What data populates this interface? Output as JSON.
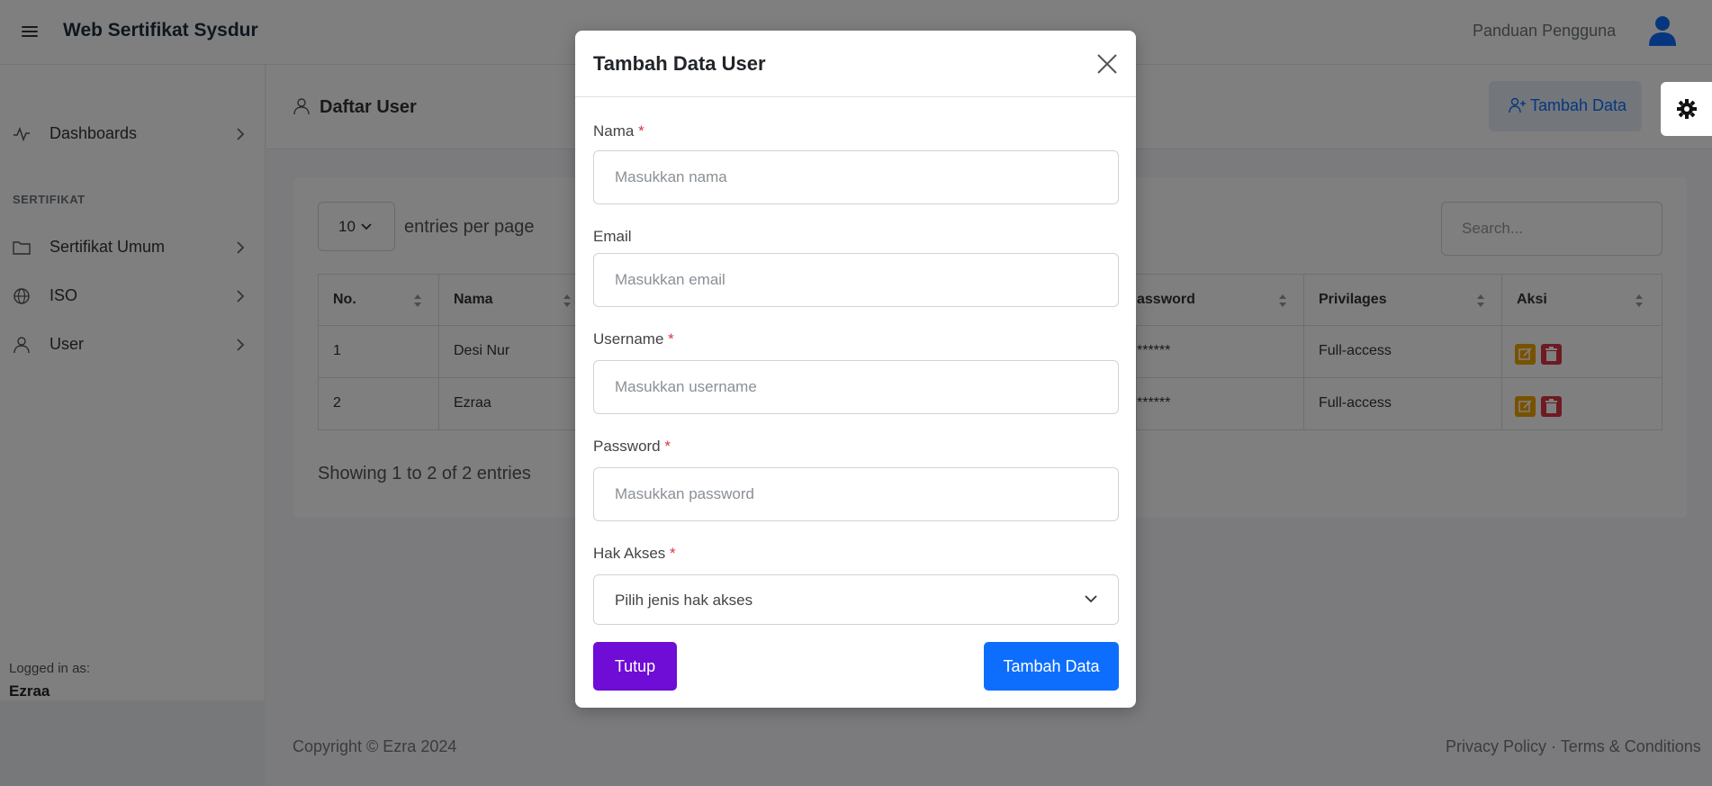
{
  "app": {
    "brand": "Web Sertifikat Sysdur",
    "help_link": "Panduan Pengguna"
  },
  "sidebar": {
    "items": [
      {
        "label": "Dashboards",
        "icon": "activity-icon"
      },
      {
        "label": "Sertifikat Umum",
        "icon": "folder-icon"
      },
      {
        "label": "ISO",
        "icon": "globe-icon"
      },
      {
        "label": "User",
        "icon": "user-icon"
      }
    ],
    "section_label": "SERTIFIKAT",
    "logged_as_label": "Logged in as:",
    "logged_user": "Ezraa"
  },
  "page": {
    "title": "Daftar User",
    "add_button": "Tambah Data"
  },
  "table_controls": {
    "per_page_value": "10",
    "per_page_label": "entries per page",
    "search_placeholder": "Search...",
    "showing": "Showing 1 to 2 of 2 entries"
  },
  "table": {
    "columns": [
      "No.",
      "Nama",
      "assword",
      "Privilages",
      "Aksi"
    ],
    "rows": [
      {
        "no": "1",
        "nama": "Desi Nur",
        "password": "******",
        "privilages": "Full-access"
      },
      {
        "no": "2",
        "nama": "Ezraa",
        "password": "******",
        "privilages": "Full-access"
      }
    ]
  },
  "footer": {
    "copyright": "Copyright © Ezra 2024",
    "privacy": "Privacy Policy",
    "separator": "·",
    "terms": "Terms & Conditions"
  },
  "modal": {
    "title": "Tambah Data User",
    "fields": {
      "nama": {
        "label": "Nama",
        "placeholder": "Masukkan nama",
        "required": "*"
      },
      "email": {
        "label": "Email",
        "placeholder": "Masukkan email"
      },
      "username": {
        "label": "Username",
        "placeholder": "Masukkan username",
        "required": "*"
      },
      "password": {
        "label": "Password",
        "placeholder": "Masukkan password",
        "required": "*"
      },
      "hak_akses": {
        "label": "Hak Akses",
        "selected": "Pilih jenis hak akses",
        "required": "*"
      }
    },
    "close_button": "Tutup",
    "submit_button": "Tambah Data"
  },
  "colors": {
    "primary": "#0d6efd",
    "purple": "#6f0cd6",
    "danger": "#dc3545",
    "warning": "#f0a500"
  }
}
